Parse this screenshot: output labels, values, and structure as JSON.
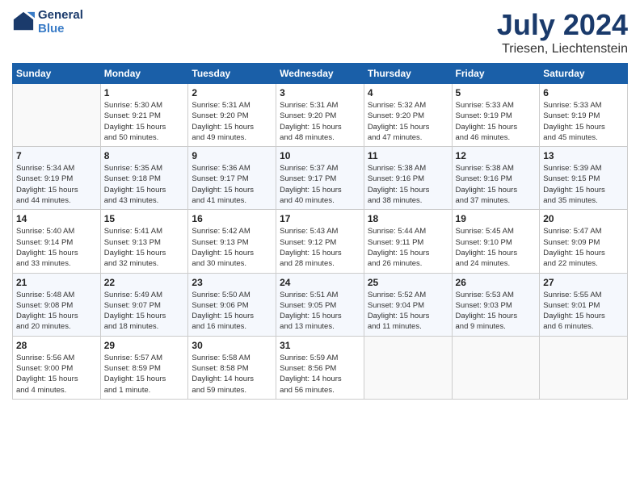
{
  "logo": {
    "line1": "General",
    "line2": "Blue"
  },
  "title": "July 2024",
  "location": "Triesen, Liechtenstein",
  "weekdays": [
    "Sunday",
    "Monday",
    "Tuesday",
    "Wednesday",
    "Thursday",
    "Friday",
    "Saturday"
  ],
  "weeks": [
    [
      {
        "day": "",
        "info": ""
      },
      {
        "day": "1",
        "info": "Sunrise: 5:30 AM\nSunset: 9:21 PM\nDaylight: 15 hours\nand 50 minutes."
      },
      {
        "day": "2",
        "info": "Sunrise: 5:31 AM\nSunset: 9:20 PM\nDaylight: 15 hours\nand 49 minutes."
      },
      {
        "day": "3",
        "info": "Sunrise: 5:31 AM\nSunset: 9:20 PM\nDaylight: 15 hours\nand 48 minutes."
      },
      {
        "day": "4",
        "info": "Sunrise: 5:32 AM\nSunset: 9:20 PM\nDaylight: 15 hours\nand 47 minutes."
      },
      {
        "day": "5",
        "info": "Sunrise: 5:33 AM\nSunset: 9:19 PM\nDaylight: 15 hours\nand 46 minutes."
      },
      {
        "day": "6",
        "info": "Sunrise: 5:33 AM\nSunset: 9:19 PM\nDaylight: 15 hours\nand 45 minutes."
      }
    ],
    [
      {
        "day": "7",
        "info": "Sunrise: 5:34 AM\nSunset: 9:19 PM\nDaylight: 15 hours\nand 44 minutes."
      },
      {
        "day": "8",
        "info": "Sunrise: 5:35 AM\nSunset: 9:18 PM\nDaylight: 15 hours\nand 43 minutes."
      },
      {
        "day": "9",
        "info": "Sunrise: 5:36 AM\nSunset: 9:17 PM\nDaylight: 15 hours\nand 41 minutes."
      },
      {
        "day": "10",
        "info": "Sunrise: 5:37 AM\nSunset: 9:17 PM\nDaylight: 15 hours\nand 40 minutes."
      },
      {
        "day": "11",
        "info": "Sunrise: 5:38 AM\nSunset: 9:16 PM\nDaylight: 15 hours\nand 38 minutes."
      },
      {
        "day": "12",
        "info": "Sunrise: 5:38 AM\nSunset: 9:16 PM\nDaylight: 15 hours\nand 37 minutes."
      },
      {
        "day": "13",
        "info": "Sunrise: 5:39 AM\nSunset: 9:15 PM\nDaylight: 15 hours\nand 35 minutes."
      }
    ],
    [
      {
        "day": "14",
        "info": "Sunrise: 5:40 AM\nSunset: 9:14 PM\nDaylight: 15 hours\nand 33 minutes."
      },
      {
        "day": "15",
        "info": "Sunrise: 5:41 AM\nSunset: 9:13 PM\nDaylight: 15 hours\nand 32 minutes."
      },
      {
        "day": "16",
        "info": "Sunrise: 5:42 AM\nSunset: 9:13 PM\nDaylight: 15 hours\nand 30 minutes."
      },
      {
        "day": "17",
        "info": "Sunrise: 5:43 AM\nSunset: 9:12 PM\nDaylight: 15 hours\nand 28 minutes."
      },
      {
        "day": "18",
        "info": "Sunrise: 5:44 AM\nSunset: 9:11 PM\nDaylight: 15 hours\nand 26 minutes."
      },
      {
        "day": "19",
        "info": "Sunrise: 5:45 AM\nSunset: 9:10 PM\nDaylight: 15 hours\nand 24 minutes."
      },
      {
        "day": "20",
        "info": "Sunrise: 5:47 AM\nSunset: 9:09 PM\nDaylight: 15 hours\nand 22 minutes."
      }
    ],
    [
      {
        "day": "21",
        "info": "Sunrise: 5:48 AM\nSunset: 9:08 PM\nDaylight: 15 hours\nand 20 minutes."
      },
      {
        "day": "22",
        "info": "Sunrise: 5:49 AM\nSunset: 9:07 PM\nDaylight: 15 hours\nand 18 minutes."
      },
      {
        "day": "23",
        "info": "Sunrise: 5:50 AM\nSunset: 9:06 PM\nDaylight: 15 hours\nand 16 minutes."
      },
      {
        "day": "24",
        "info": "Sunrise: 5:51 AM\nSunset: 9:05 PM\nDaylight: 15 hours\nand 13 minutes."
      },
      {
        "day": "25",
        "info": "Sunrise: 5:52 AM\nSunset: 9:04 PM\nDaylight: 15 hours\nand 11 minutes."
      },
      {
        "day": "26",
        "info": "Sunrise: 5:53 AM\nSunset: 9:03 PM\nDaylight: 15 hours\nand 9 minutes."
      },
      {
        "day": "27",
        "info": "Sunrise: 5:55 AM\nSunset: 9:01 PM\nDaylight: 15 hours\nand 6 minutes."
      }
    ],
    [
      {
        "day": "28",
        "info": "Sunrise: 5:56 AM\nSunset: 9:00 PM\nDaylight: 15 hours\nand 4 minutes."
      },
      {
        "day": "29",
        "info": "Sunrise: 5:57 AM\nSunset: 8:59 PM\nDaylight: 15 hours\nand 1 minute."
      },
      {
        "day": "30",
        "info": "Sunrise: 5:58 AM\nSunset: 8:58 PM\nDaylight: 14 hours\nand 59 minutes."
      },
      {
        "day": "31",
        "info": "Sunrise: 5:59 AM\nSunset: 8:56 PM\nDaylight: 14 hours\nand 56 minutes."
      },
      {
        "day": "",
        "info": ""
      },
      {
        "day": "",
        "info": ""
      },
      {
        "day": "",
        "info": ""
      }
    ]
  ]
}
